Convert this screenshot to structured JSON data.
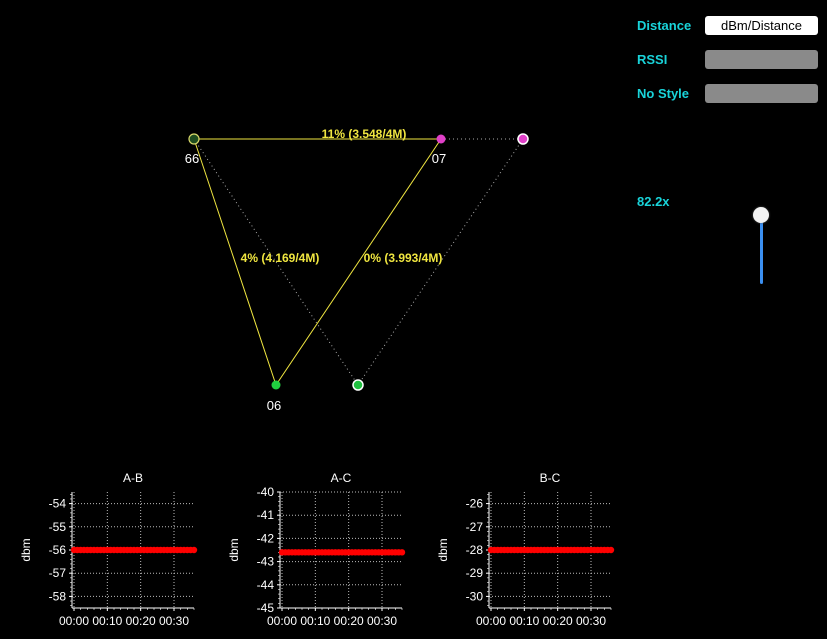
{
  "controls": {
    "distance_label": "Distance",
    "distance_value": "dBm/Distance",
    "rssi_label": "RSSI",
    "rssi_value": "",
    "style_label": "No Style",
    "style_value": "",
    "zoom_label": "82.2x",
    "zoom_level": 0.0
  },
  "graph": {
    "nodes": [
      {
        "id": "66",
        "label": "66",
        "color": "#1f4d1f"
      },
      {
        "id": "07",
        "label": "07",
        "color": "#e040c8"
      },
      {
        "id": "06",
        "label": "06",
        "color": "#20d040"
      },
      {
        "id": "p1",
        "label": "",
        "color": "#e040c8"
      },
      {
        "id": "p2",
        "label": "",
        "color": "#20c040"
      }
    ],
    "edge_labels": [
      {
        "text": "11% (3.548/4M)"
      },
      {
        "text": "4% (4.169/4M)"
      },
      {
        "text": "0% (3.993/4M)"
      }
    ]
  },
  "chart_data": [
    {
      "type": "scatter",
      "title": "A-B",
      "ylabel": "dbm",
      "ylim": [
        -58.5,
        -53.5
      ],
      "yticks": [
        "-54",
        "-55",
        "-56",
        "-57",
        "-58"
      ],
      "xticks": [
        "00:00",
        "00:10",
        "00:20",
        "00:30"
      ],
      "xlim": [
        0,
        36
      ],
      "x_count": 37,
      "values": -56,
      "color": "#ff0000"
    },
    {
      "type": "scatter",
      "title": "A-C",
      "ylabel": "dbm",
      "ylim": [
        -45,
        -40
      ],
      "yticks": [
        "-40",
        "-41",
        "-42",
        "-43",
        "-44",
        "-45"
      ],
      "xticks": [
        "00:00",
        "00:10",
        "00:20",
        "00:30"
      ],
      "xlim": [
        0,
        36
      ],
      "x_count": 37,
      "values": -42.6,
      "color": "#ff0000"
    },
    {
      "type": "scatter",
      "title": "B-C",
      "ylabel": "dbm",
      "ylim": [
        -30.5,
        -25.5
      ],
      "yticks": [
        "-26",
        "-27",
        "-28",
        "-29",
        "-30"
      ],
      "xticks": [
        "00:00",
        "00:10",
        "00:20",
        "00:30"
      ],
      "xlim": [
        0,
        36
      ],
      "x_count": 37,
      "values": -28,
      "color": "#ff0000"
    }
  ]
}
